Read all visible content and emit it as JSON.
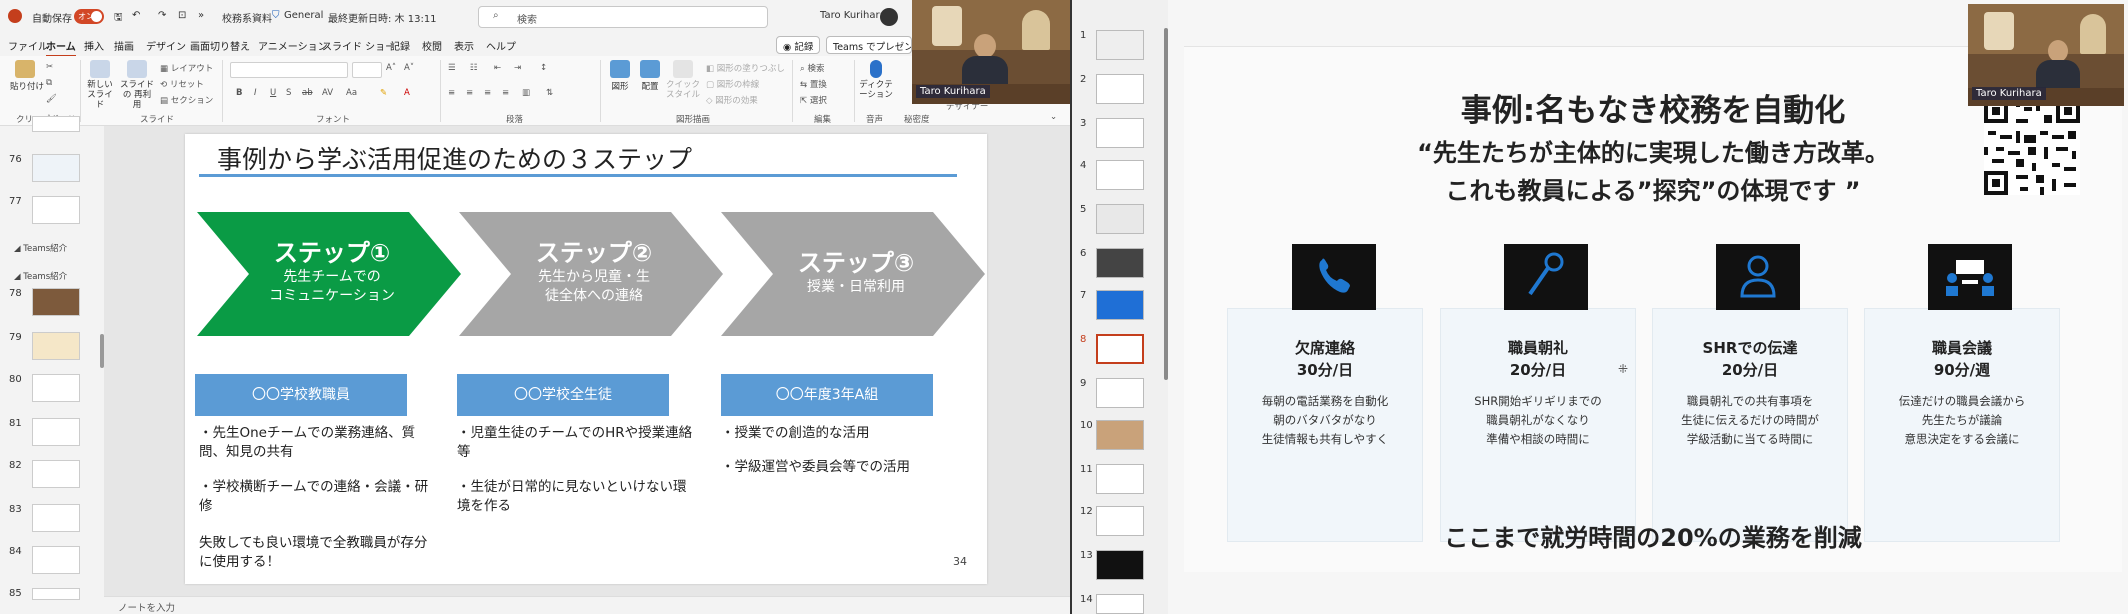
{
  "left_window": {
    "titlebar": {
      "autosave_label": "自動保存",
      "autosave_state": "オン",
      "file_name": "校務系資料",
      "sensitivity": "General",
      "last_updated": "最終更新日時: 木 13:11",
      "search_placeholder": "検索",
      "user_name": "Taro Kurihara"
    },
    "menu_tabs": [
      "ファイル",
      "ホーム",
      "挿入",
      "描画",
      "デザイン",
      "画面切り替え",
      "アニメーション",
      "スライド ショー",
      "記録",
      "校閲",
      "表示",
      "ヘルプ"
    ],
    "menu_right": {
      "record_label": "記録",
      "teams_label": "Teams でプレゼン"
    },
    "ribbon": {
      "paste": "貼り付け",
      "new_slide": "新しい スライド",
      "reuse_slide": "スライドの 再利用",
      "layout": "レイアウト",
      "reset": "リセット",
      "section": "セクション",
      "shapes": "図形",
      "arrange": "配置",
      "quick_styles": "クイック スタイル",
      "shape_fill": "図形の塗りつぶし",
      "shape_outline": "図形の枠線",
      "shape_effects": "図形の効果",
      "find": "検索",
      "replace": "置換",
      "select": "選択",
      "dictate": "ディクテーション",
      "designer": "デザイナー",
      "groups": {
        "clipboard": "クリップボード",
        "slides": "スライド",
        "font": "フォント",
        "paragraph": "段落",
        "drawing": "図形描画",
        "editing": "編集",
        "voice": "音声",
        "sensitivity": "秘密度"
      }
    },
    "thumbnails": {
      "numbers": [
        "76",
        "77",
        "78",
        "79",
        "80",
        "81",
        "82",
        "83",
        "84",
        "85"
      ],
      "sections": [
        "Teams紹介",
        "Teams紹介"
      ]
    },
    "slide": {
      "title": "事例から学ぶ活用促進のための３ステップ",
      "steps": [
        {
          "title": "ステップ①",
          "subtitle_lines": [
            "先生チームでの",
            "コミュニケーション"
          ],
          "color": "#0a9b45"
        },
        {
          "title": "ステップ②",
          "subtitle_lines": [
            "先生から児童・生",
            "徒全体への連絡"
          ],
          "color": "#a6a6a6"
        },
        {
          "title": "ステップ③",
          "subtitle_lines": [
            "授業・日常利用"
          ],
          "color": "#a6a6a6"
        }
      ],
      "groups": [
        {
          "label": "〇〇学校教職員",
          "bullets": [
            "・先生Oneチームでの業務連絡、質問、知見の共有",
            "・学校横断チームでの連絡・会議・研修",
            "失敗しても良い環境で全教職員が存分に使用する！"
          ]
        },
        {
          "label": "〇〇学校全生徒",
          "bullets": [
            "・児童生徒のチームでのHRや授業連絡等",
            "・生徒が日常的に見ないといけない環境を作る"
          ]
        },
        {
          "label": "〇〇年度3年A組",
          "bullets": [
            "・授業での創造的な活用",
            "・学級運営や委員会等での活用"
          ]
        }
      ],
      "page_number": "34"
    },
    "notes_placeholder": "ノートを入力",
    "camera_name": "Taro Kurihara"
  },
  "right_window": {
    "thumb_numbers": [
      "1",
      "2",
      "3",
      "4",
      "5",
      "6",
      "7",
      "8",
      "9",
      "10",
      "11",
      "12",
      "13",
      "14"
    ],
    "selected_slide": "8",
    "slide": {
      "title": "事例:名もなき校務を自動化",
      "subtitle_line1": "“先生たちが主体的に実現した働き方改革。",
      "subtitle_line2": "これも教員による”探究”の体現です ”",
      "cards": [
        {
          "icon": "phone-icon",
          "title": "欠席連絡",
          "time": "30分/日",
          "lines": [
            "毎朝の電話業務を自動化",
            "朝のバタバタがなり",
            "生徒情報も共有しやすく"
          ]
        },
        {
          "icon": "microphone-icon",
          "title": "職員朝礼",
          "time": "20分/日",
          "lines": [
            "SHR開始ギリギリまでの",
            "職員朝礼がなくなり",
            "準備や相談の時間に"
          ]
        },
        {
          "icon": "person-icon",
          "title": "SHRでの伝達",
          "time": "20分/日",
          "lines": [
            "職員朝礼での共有事項を",
            "生徒に伝えるだけの時間が",
            "学級活動に当てる時間に"
          ]
        },
        {
          "icon": "meeting-icon",
          "title": "職員会議",
          "time": "90分/週",
          "lines": [
            "伝達だけの職員会議から",
            "先生たちが議論",
            "意思決定をする会議に"
          ]
        }
      ],
      "footer": "ここまで就労時間の20%の業務を削減"
    },
    "camera_name": "Taro Kurihara",
    "colors": {
      "icon_bg": "#111111",
      "icon_fg": "#1f78d1",
      "selected_border": "#c43e1c"
    }
  }
}
